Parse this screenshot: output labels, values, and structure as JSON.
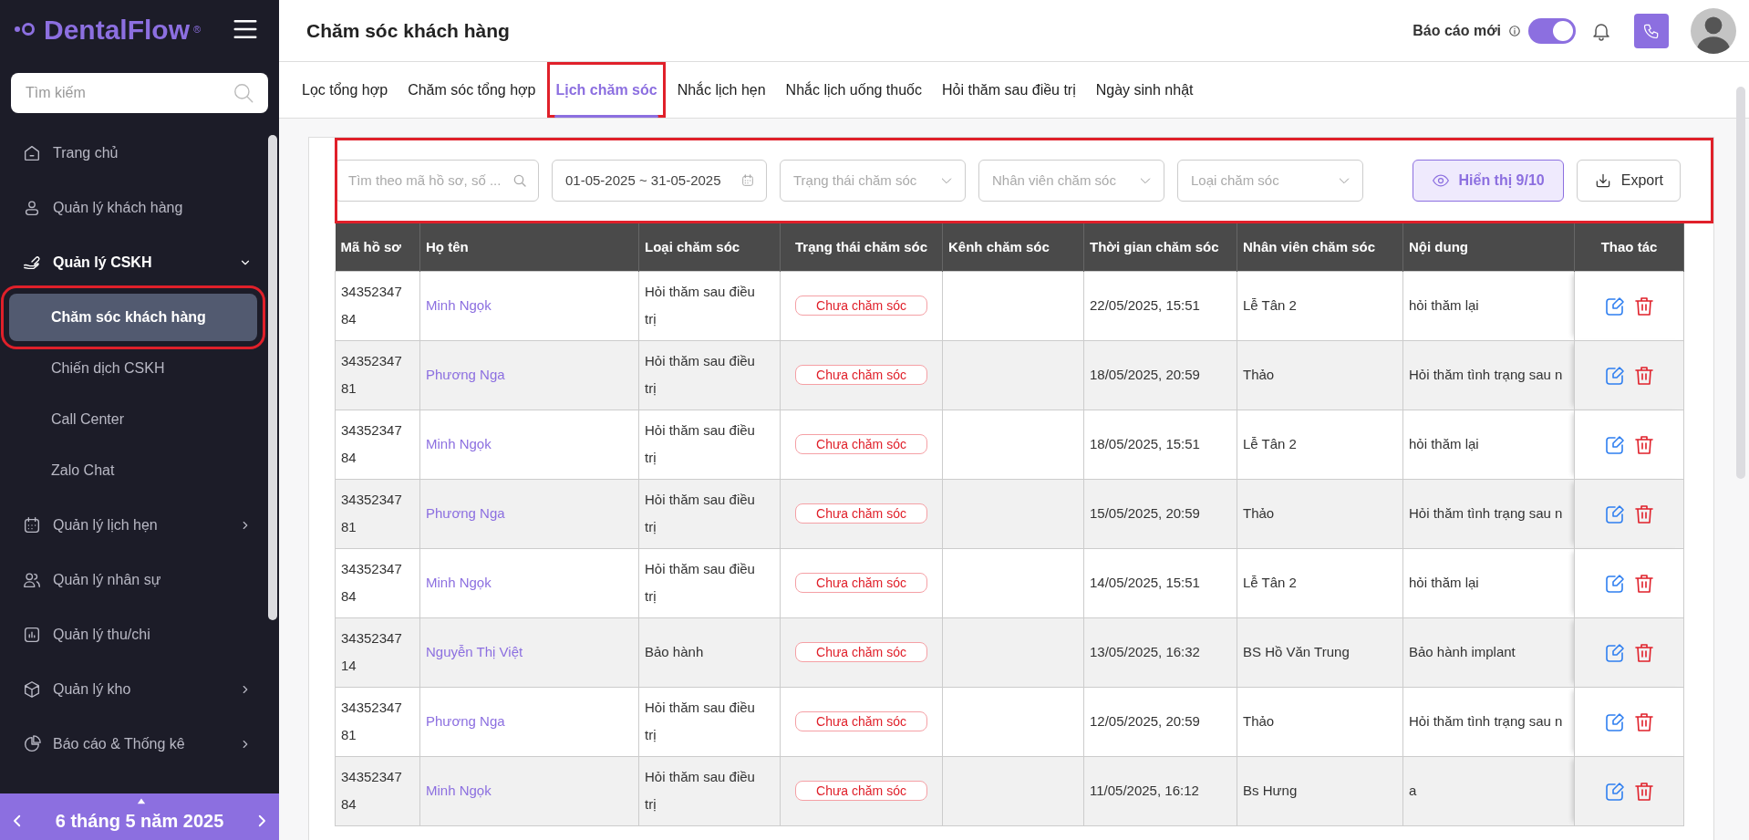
{
  "sidebar": {
    "logo": "DentalFlow",
    "logo_mark": "®",
    "search": {
      "placeholder": "Tìm kiếm"
    },
    "items": [
      {
        "label": "Trang chủ",
        "selected": false
      },
      {
        "label": "Quản lý khách hàng",
        "selected": false
      },
      {
        "label": "Quản lý CSKH",
        "selected": false,
        "expanded": true,
        "children": [
          {
            "label": "Chăm sóc khách hàng",
            "selected": true,
            "highlighted": true
          },
          {
            "label": "Chiến dịch CSKH",
            "selected": false,
            "highlighted": false
          },
          {
            "label": "Call Center",
            "selected": false,
            "highlighted": false
          },
          {
            "label": "Zalo Chat",
            "selected": false,
            "highlighted": false
          }
        ]
      },
      {
        "label": "Quản lý lịch hẹn",
        "selected": false,
        "expanded": false
      },
      {
        "label": "Quản lý nhân sự",
        "selected": false
      },
      {
        "label": "Quản lý thu/chi",
        "selected": false
      },
      {
        "label": "Quản lý kho",
        "selected": false,
        "expanded": false
      },
      {
        "label": "Báo cáo & Thống kê",
        "selected": false,
        "expanded": false
      }
    ],
    "date_bar": {
      "label": "6 tháng 5 năm 2025"
    }
  },
  "header": {
    "title": "Chăm sóc khách hàng",
    "report_toggle": {
      "label": "Báo cáo mới",
      "on": true
    }
  },
  "tabs": [
    {
      "label": "Lọc tổng hợp",
      "selected": false,
      "highlighted": false
    },
    {
      "label": "Chăm sóc tổng hợp",
      "selected": false,
      "highlighted": false
    },
    {
      "label": "Lịch chăm sóc",
      "selected": true,
      "highlighted": true
    },
    {
      "label": "Nhắc lịch hẹn",
      "selected": false,
      "highlighted": false
    },
    {
      "label": "Nhắc lịch uống thuốc",
      "selected": false,
      "highlighted": false
    },
    {
      "label": "Hỏi thăm sau điều trị",
      "selected": false,
      "highlighted": false
    },
    {
      "label": "Ngày sinh nhật",
      "selected": false,
      "highlighted": false
    }
  ],
  "filters": {
    "highlighted": true,
    "search": {
      "placeholder": "Tìm theo mã hồ sơ, số ..."
    },
    "date_range": {
      "value": "01-05-2025 ~ 31-05-2025"
    },
    "selects": [
      {
        "placeholder": "Trạng thái chăm sóc"
      },
      {
        "placeholder": "Nhân viên chăm sóc"
      },
      {
        "placeholder": "Loại chăm sóc"
      }
    ],
    "buttons": [
      {
        "label": "Hiển thị 9/10",
        "kind": "display"
      },
      {
        "label": "Export",
        "kind": "export"
      }
    ]
  },
  "table": {
    "columns": [
      "Mã hồ sơ",
      "Họ tên",
      "Loại chăm sóc",
      "Trạng thái chăm sóc",
      "Kênh chăm sóc",
      "Thời gian chăm sóc",
      "Nhân viên chăm sóc",
      "Nội dung",
      "Thao tác"
    ],
    "rows": [
      {
        "id": "3435234784",
        "name": "Minh Ngọk",
        "care_type": "Hỏi thăm sau điều trị",
        "status": "Chưa chăm sóc",
        "time": "22/05/2025, 15:51",
        "staff": "Lễ Tân 2",
        "content": "hỏi thăm lại"
      },
      {
        "id": "3435234781",
        "name": "Phương Nga",
        "care_type": "Hỏi thăm sau điều trị",
        "status": "Chưa chăm sóc",
        "time": "18/05/2025, 20:59",
        "staff": "Thảo",
        "content": "Hỏi thăm tình trạng sau n"
      },
      {
        "id": "3435234784",
        "name": "Minh Ngọk",
        "care_type": "Hỏi thăm sau điều trị",
        "status": "Chưa chăm sóc",
        "time": "18/05/2025, 15:51",
        "staff": "Lễ Tân 2",
        "content": "hỏi thăm lại"
      },
      {
        "id": "3435234781",
        "name": "Phương Nga",
        "care_type": "Hỏi thăm sau điều trị",
        "status": "Chưa chăm sóc",
        "time": "15/05/2025, 20:59",
        "staff": "Thảo",
        "content": "Hỏi thăm tình trạng sau n"
      },
      {
        "id": "3435234784",
        "name": "Minh Ngọk",
        "care_type": "Hỏi thăm sau điều trị",
        "status": "Chưa chăm sóc",
        "time": "14/05/2025, 15:51",
        "staff": "Lễ Tân 2",
        "content": "hỏi thăm lại"
      },
      {
        "id": "3435234714",
        "name": "Nguyễn Thị Việt",
        "care_type": "Bảo hành",
        "status": "Chưa chăm sóc",
        "time": "13/05/2025, 16:32",
        "staff": "BS Hồ Văn Trung",
        "content": "Bảo hành implant"
      },
      {
        "id": "3435234781",
        "name": "Phương Nga",
        "care_type": "Hỏi thăm sau điều trị",
        "status": "Chưa chăm sóc",
        "time": "12/05/2025, 20:59",
        "staff": "Thảo",
        "content": "Hỏi thăm tình trạng sau n"
      },
      {
        "id": "3435234784",
        "name": "Minh Ngọk",
        "care_type": "Hỏi thăm sau điều trị",
        "status": "Chưa chăm sóc",
        "time": "11/05/2025, 16:12",
        "staff": "Bs Hưng",
        "content": "a"
      }
    ]
  }
}
